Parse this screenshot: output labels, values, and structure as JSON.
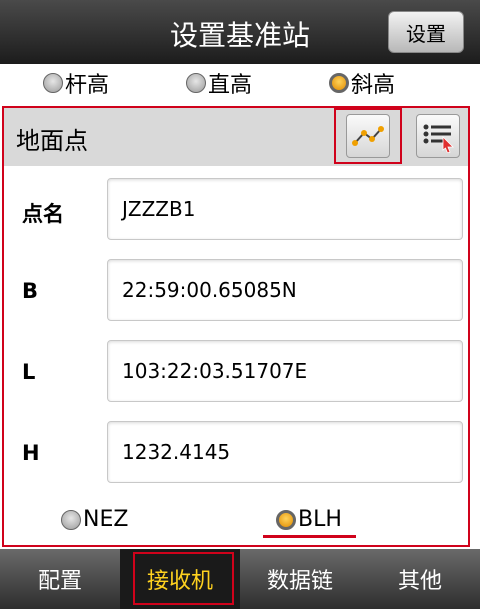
{
  "header": {
    "title": "设置基准站",
    "settings_label": "设置"
  },
  "antenna_modes": [
    {
      "label": "杆高",
      "selected": false
    },
    {
      "label": "直高",
      "selected": false
    },
    {
      "label": "斜高",
      "selected": true
    }
  ],
  "panel": {
    "title": "地面点",
    "icons": [
      "line-chart-icon",
      "list-pointer-icon"
    ],
    "fields": [
      {
        "label": "点名",
        "value": "JZZZB1"
      },
      {
        "label": "B",
        "value": "22:59:00.65085N"
      },
      {
        "label": "L",
        "value": "103:22:03.51707E"
      },
      {
        "label": "H",
        "value": "1232.4145"
      }
    ],
    "coord_modes": [
      {
        "label": "NEZ",
        "selected": false
      },
      {
        "label": "BLH",
        "selected": true
      }
    ]
  },
  "tabs": [
    {
      "label": "配置",
      "active": false
    },
    {
      "label": "接收机",
      "active": true
    },
    {
      "label": "数据链",
      "active": false
    },
    {
      "label": "其他",
      "active": false
    }
  ],
  "colors": {
    "accent": "#ffd21f",
    "annotation": "#d0021b",
    "radio_selected": "#f0a000"
  }
}
